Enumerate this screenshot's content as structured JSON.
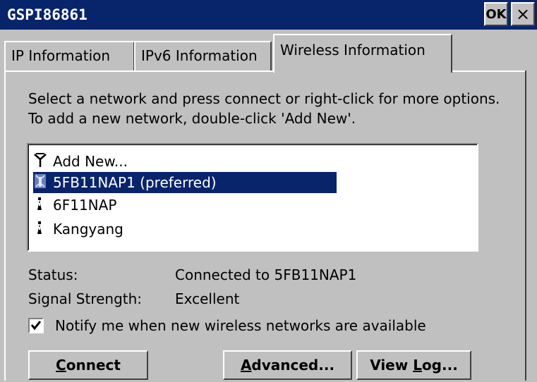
{
  "window": {
    "title": "GSPI86861",
    "ok_label": "OK",
    "close_label": "×"
  },
  "tabs": [
    {
      "label": "IP Information"
    },
    {
      "label": "IPv6 Information"
    },
    {
      "label": "Wireless Information"
    }
  ],
  "instructions": "Select a network and press connect or right-click for more options.  To add a new network, double-click 'Add New'.",
  "networks": [
    {
      "label": "Add New...",
      "icon": "antenna-icon"
    },
    {
      "label": "5FB11NAP1 (preferred)",
      "icon": "wireless-connected-icon",
      "selected": true
    },
    {
      "label": "6F11NAP",
      "icon": "access-point-icon"
    },
    {
      "label": "Kangyang",
      "icon": "access-point-icon"
    }
  ],
  "status": {
    "label": "Status:",
    "value": "Connected to 5FB11NAP1"
  },
  "signal": {
    "label": "Signal Strength:",
    "value": "Excellent"
  },
  "notify": {
    "label": "Notify me when new wireless networks are available",
    "checked": true
  },
  "buttons": {
    "connect": {
      "mnemonic": "C",
      "rest": "onnect"
    },
    "advanced": {
      "mnemonic": "A",
      "rest": "dvanced..."
    },
    "viewlog": {
      "prefix": "View ",
      "mnemonic": "L",
      "rest": "og..."
    }
  },
  "colors": {
    "titlebar": "#08246b",
    "selection": "#08246b",
    "face": "#c0c0c0"
  }
}
